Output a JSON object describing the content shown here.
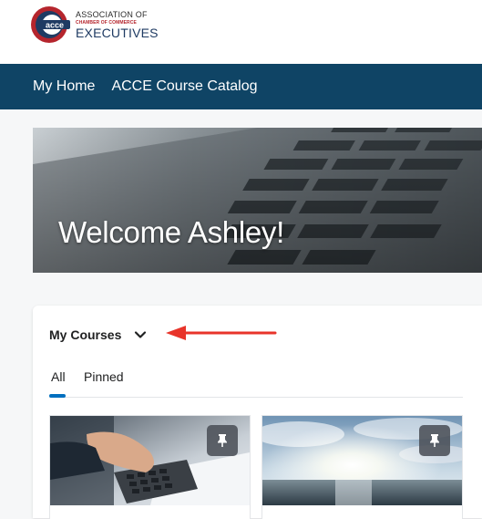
{
  "logo": {
    "line1": "ASSOCIATION OF",
    "line2": "CHAMBER OF COMMERCE",
    "line3": "EXECUTIVES",
    "badge_text": "acce"
  },
  "nav": {
    "home_label": "My Home",
    "catalog_label": "ACCE Course Catalog"
  },
  "hero": {
    "title": "Welcome Ashley!"
  },
  "courses_widget": {
    "title": "My Courses",
    "tabs": [
      {
        "label": "All",
        "selected": true
      },
      {
        "label": "Pinned",
        "selected": false
      }
    ],
    "cards": [
      {
        "image": "calculator-photo",
        "icon": "pin-icon"
      },
      {
        "image": "sunset-sea-photo",
        "icon": "pin-icon"
      }
    ]
  },
  "colors": {
    "nav_bg": "#0f4465",
    "accent_red": "#e8342a",
    "tab_indicator": "#006fbf"
  }
}
